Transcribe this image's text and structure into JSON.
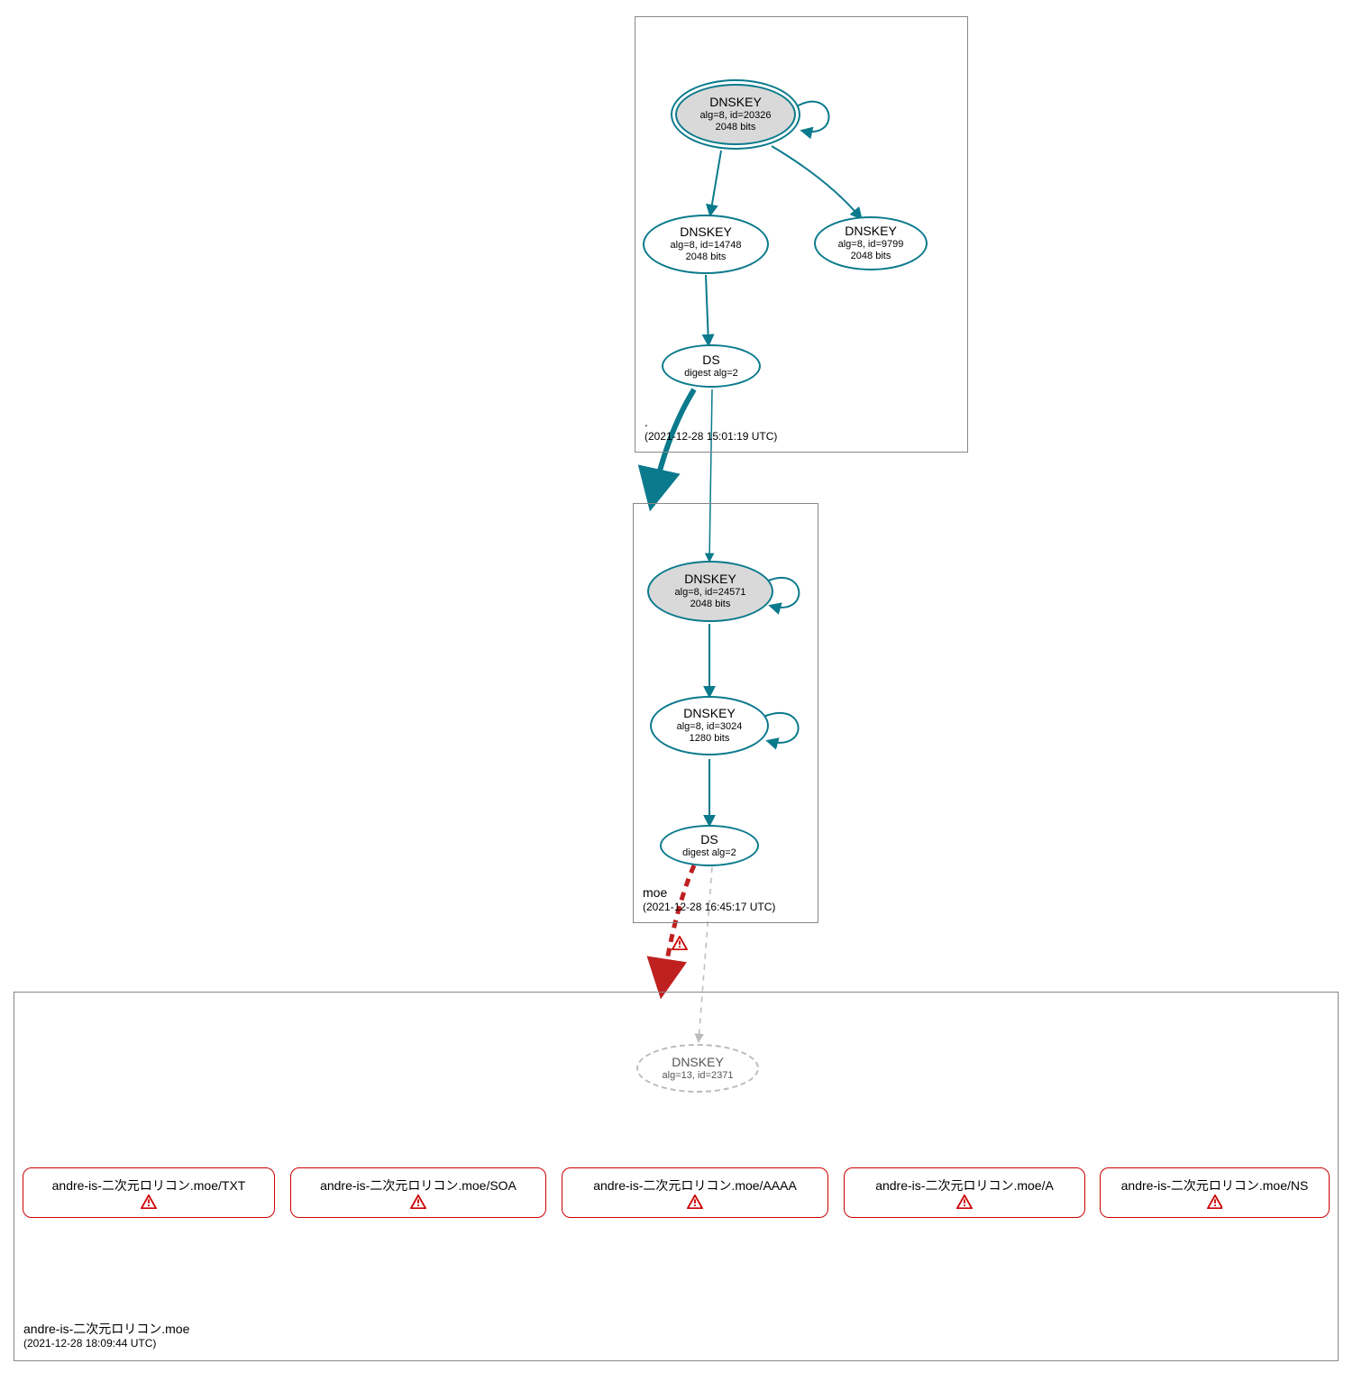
{
  "colors": {
    "teal": "#0a7a8c",
    "red": "#cc0000",
    "grayDash": "#bbbbbb",
    "boxBorder": "#888888"
  },
  "zones": {
    "root": {
      "label": ".",
      "timestamp": "(2021-12-28 15:01:19 UTC)",
      "nodes": {
        "ksk": {
          "title": "DNSKEY",
          "sub1": "alg=8, id=20326",
          "sub2": "2048 bits"
        },
        "zsk": {
          "title": "DNSKEY",
          "sub1": "alg=8, id=14748",
          "sub2": "2048 bits"
        },
        "other": {
          "title": "DNSKEY",
          "sub1": "alg=8, id=9799",
          "sub2": "2048 bits"
        },
        "ds": {
          "title": "DS",
          "sub1": "digest alg=2"
        }
      }
    },
    "moe": {
      "label": "moe",
      "timestamp": "(2021-12-28 16:45:17 UTC)",
      "nodes": {
        "ksk": {
          "title": "DNSKEY",
          "sub1": "alg=8, id=24571",
          "sub2": "2048 bits"
        },
        "zsk": {
          "title": "DNSKEY",
          "sub1": "alg=8, id=3024",
          "sub2": "1280 bits"
        },
        "ds": {
          "title": "DS",
          "sub1": "digest alg=2"
        }
      }
    },
    "child": {
      "label": "andre-is-二次元ロリコン.moe",
      "timestamp": "(2021-12-28 18:09:44 UTC)",
      "nodes": {
        "dnskey": {
          "title": "DNSKEY",
          "sub1": "alg=13, id=2371"
        }
      },
      "records": [
        {
          "label": "andre-is-二次元ロリコン.moe/TXT"
        },
        {
          "label": "andre-is-二次元ロリコン.moe/SOA"
        },
        {
          "label": "andre-is-二次元ロリコン.moe/AAAA"
        },
        {
          "label": "andre-is-二次元ロリコン.moe/A"
        },
        {
          "label": "andre-is-二次元ロリコン.moe/NS"
        }
      ]
    }
  }
}
